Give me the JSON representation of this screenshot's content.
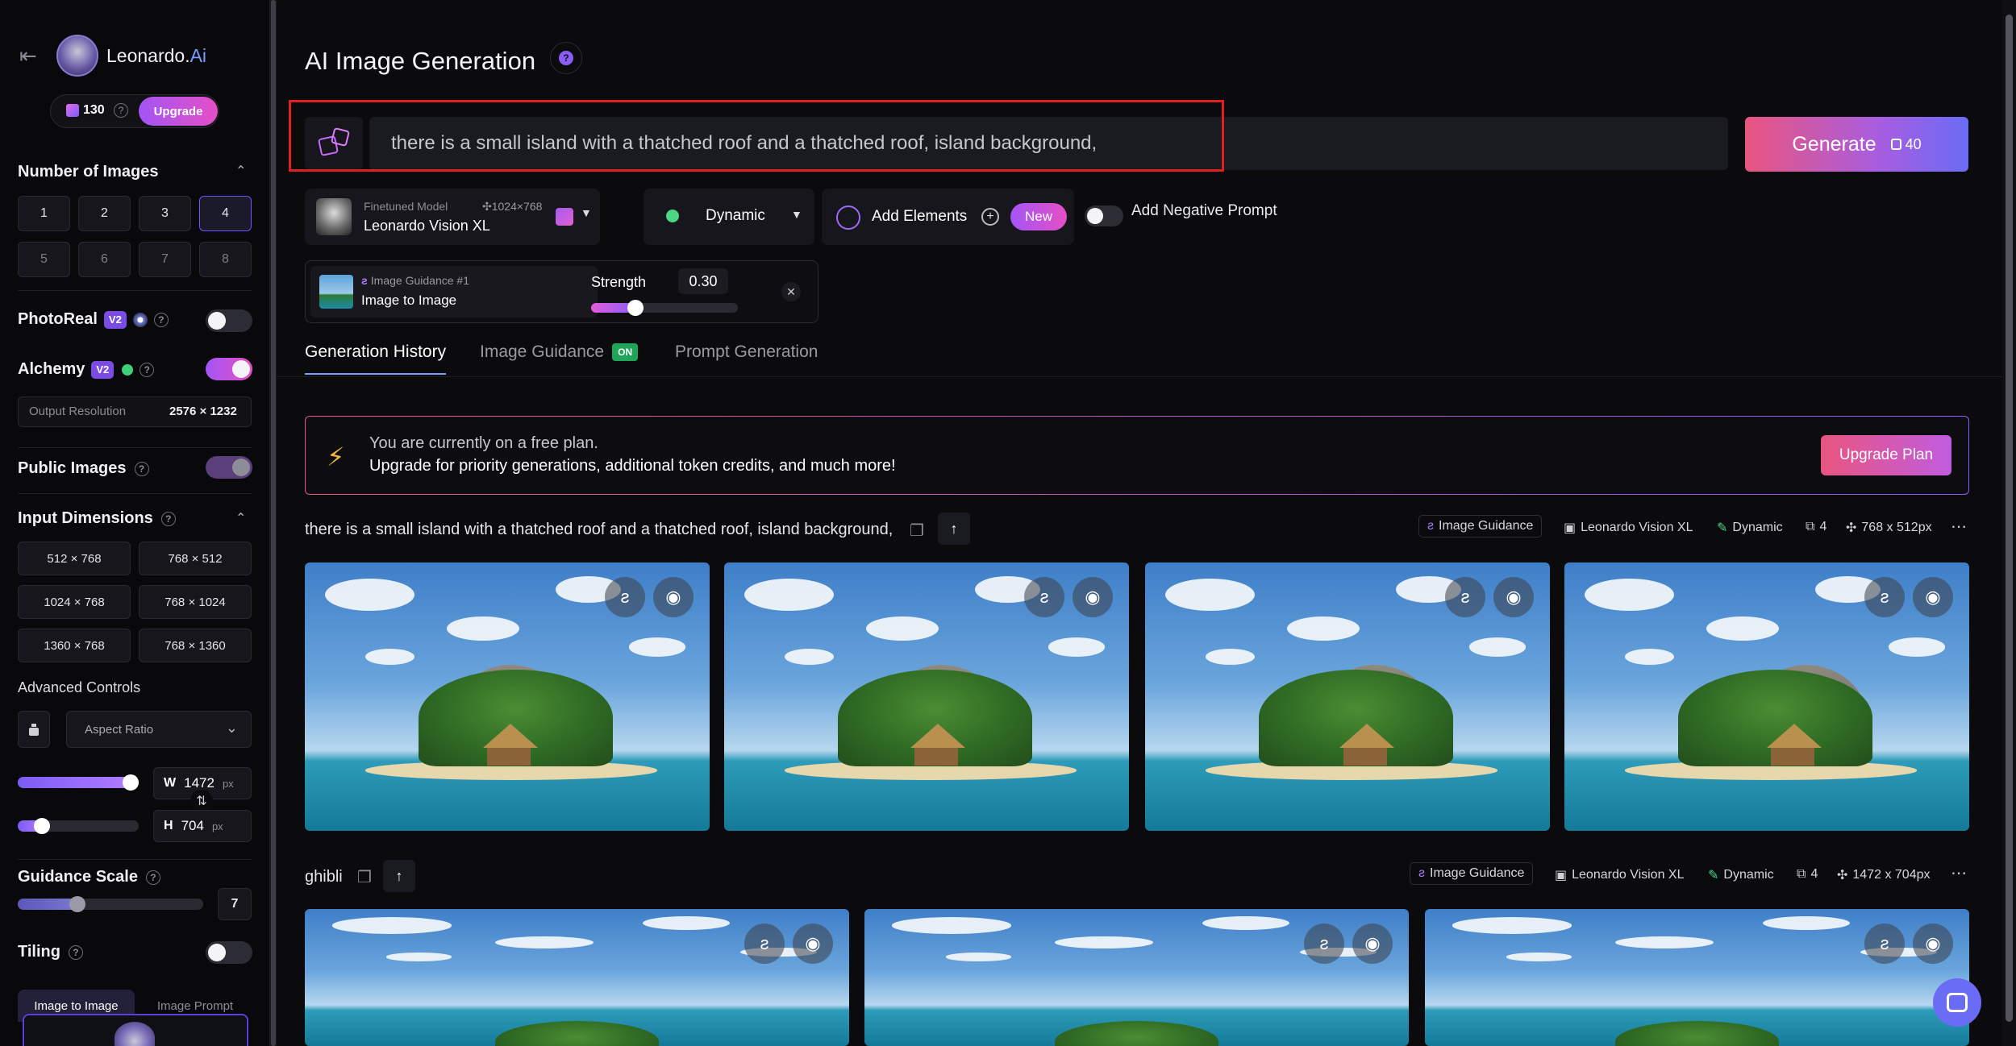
{
  "sidebar": {
    "brand": "Leonardo.",
    "brand_accent": "Ai",
    "tokens": "130",
    "upgrade_label": "Upgrade",
    "number_of_images": {
      "label": "Number of Images",
      "options": [
        "1",
        "2",
        "3",
        "4",
        "5",
        "6",
        "7",
        "8"
      ],
      "selected": "4"
    },
    "photoreal": {
      "label": "PhotoReal",
      "badge": "V2",
      "on": false
    },
    "alchemy": {
      "label": "Alchemy",
      "badge": "V2",
      "on": true
    },
    "output_resolution": {
      "label": "Output Resolution",
      "value": "2576 × 1232"
    },
    "public_images": {
      "label": "Public Images",
      "on": true
    },
    "input_dimensions": {
      "label": "Input Dimensions",
      "options": [
        "512 × 768",
        "768 × 512",
        "1024 × 768",
        "768 × 1024",
        "1360 × 768",
        "768 × 1360"
      ]
    },
    "advanced_controls": "Advanced Controls",
    "aspect_ratio": "Aspect Ratio",
    "width": {
      "letter": "W",
      "value": "1472",
      "unit": "px",
      "slider_fraction": 0.93
    },
    "height": {
      "letter": "H",
      "value": "704",
      "unit": "px",
      "slider_fraction": 0.2
    },
    "guidance_scale": {
      "label": "Guidance Scale",
      "value": "7",
      "slider_fraction": 0.32
    },
    "tiling": {
      "label": "Tiling",
      "on": false
    },
    "bottom_tabs": [
      "Image to Image",
      "Image Prompt"
    ]
  },
  "header": {
    "title": "AI Image Generation",
    "help_icon": "question-icon"
  },
  "prompt": {
    "text": "there is a small island with a thatched roof and a thatched roof, island background,",
    "generate_label": "Generate",
    "generate_cost": "40"
  },
  "model": {
    "caption": "Finetuned Model",
    "name": "Leonardo Vision XL",
    "size": "1024×768"
  },
  "style": {
    "name": "Dynamic"
  },
  "elements": {
    "label": "Add Elements",
    "badge": "New"
  },
  "negative_prompt": {
    "label": "Add Negative Prompt",
    "on": false
  },
  "guidance_card": {
    "caption": "Image Guidance #1",
    "title": "Image to Image",
    "strength_label": "Strength",
    "strength_value": "0.30",
    "strength_fraction": 0.3
  },
  "tabs": [
    {
      "label": "Generation History",
      "active": true
    },
    {
      "label": "Image Guidance",
      "badge": "ON"
    },
    {
      "label": "Prompt Generation"
    }
  ],
  "banner": {
    "line1": "You are currently on a free plan.",
    "line2": "Upgrade for priority generations, additional token credits, and much more!",
    "button": "Upgrade Plan"
  },
  "generations": [
    {
      "prompt": "there is a small island with a thatched roof and a thatched roof, island background,",
      "guidance": "Image Guidance",
      "model": "Leonardo Vision XL",
      "style": "Dynamic",
      "count": "4",
      "dims": "768 x 512px"
    },
    {
      "prompt": "ghibli",
      "guidance": "Image Guidance",
      "model": "Leonardo Vision XL",
      "style": "Dynamic",
      "count": "4",
      "dims": "1472 x 704px"
    }
  ],
  "colors": {
    "accent_purple": "#7b4ce5",
    "generate_gradient_start": "#e9557f",
    "generate_gradient_end": "#6a6cf5",
    "highlight_box": "#e02020",
    "on_badge": "#1fa55a"
  }
}
